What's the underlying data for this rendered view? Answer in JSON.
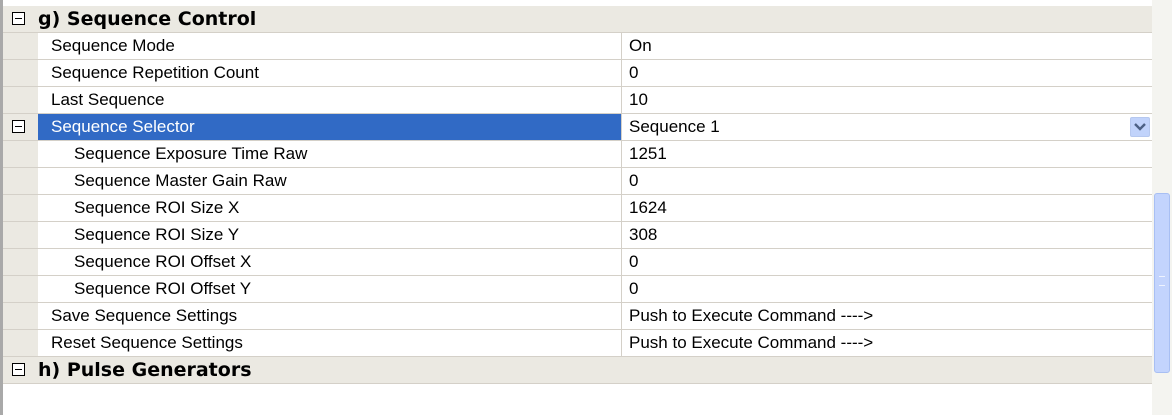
{
  "category_top": {
    "title": "g) Sequence Control"
  },
  "rows": [
    {
      "name": "Sequence Mode",
      "value": "On"
    },
    {
      "name": "Sequence Repetition Count",
      "value": "0"
    },
    {
      "name": "Last Sequence",
      "value": "10"
    },
    {
      "name": "Sequence Selector",
      "value": "Sequence 1",
      "selected": true,
      "expandable": true,
      "dropdown": true
    },
    {
      "name": "Sequence Exposure Time Raw",
      "value": "1251",
      "indent": true
    },
    {
      "name": "Sequence Master Gain Raw",
      "value": "0",
      "indent": true
    },
    {
      "name": "Sequence ROI Size X",
      "value": "1624",
      "indent": true
    },
    {
      "name": "Sequence ROI Size Y",
      "value": "308",
      "indent": true
    },
    {
      "name": "Sequence ROI Offset X",
      "value": "0",
      "indent": true
    },
    {
      "name": "Sequence ROI Offset Y",
      "value": "0",
      "indent": true
    },
    {
      "name": "Save Sequence Settings",
      "value": "Push to Execute Command ---->"
    },
    {
      "name": "Reset Sequence Settings",
      "value": "Push to Execute Command ---->"
    }
  ],
  "category_bottom": {
    "title": "h) Pulse Generators"
  },
  "icons": {
    "collapse": "minus-box-icon",
    "dropdown": "chevron-down-icon"
  },
  "colors": {
    "selection": "#316ac5",
    "category_bg": "#ebe9e2",
    "grid_line": "#d4d0c8"
  }
}
